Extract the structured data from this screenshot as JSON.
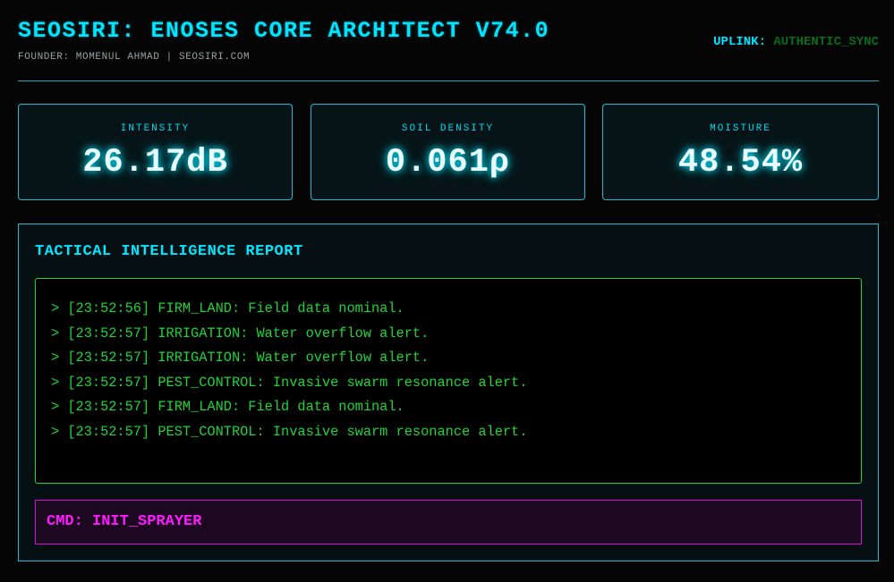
{
  "header": {
    "title": "SEOSIRI: ENOSES CORE ARCHITECT V74.0",
    "subtitle": "FOUNDER: MOMENUL AHMAD | SEOSIRI.COM",
    "uplink_label": "UPLINK:",
    "uplink_value": "AUTHENTIC_SYNC"
  },
  "metrics": [
    {
      "label": "INTENSITY",
      "value": "26.17dB"
    },
    {
      "label": "SOIL DENSITY",
      "value": "0.061ρ"
    },
    {
      "label": "MOISTURE",
      "value": "48.54%"
    }
  ],
  "report": {
    "title": "TACTICAL INTELLIGENCE REPORT",
    "lines": [
      "> [23:52:56] FIRM_LAND: Field data nominal.",
      "> [23:52:57] IRRIGATION: Water overflow alert.",
      "> [23:52:57] IRRIGATION: Water overflow alert.",
      "> [23:52:57] PEST_CONTROL: Invasive swarm resonance alert.",
      "> [23:52:57] FIRM_LAND: Field data nominal.",
      "> [23:52:57] PEST_CONTROL: Invasive swarm resonance alert."
    ],
    "command": "CMD: INIT_SPRAYER"
  },
  "colors": {
    "accent": "#00e5ff",
    "log_green": "#1fd438",
    "uplink_green": "#0a6b1c",
    "command_magenta": "#ff1aff",
    "background": "#050505"
  }
}
